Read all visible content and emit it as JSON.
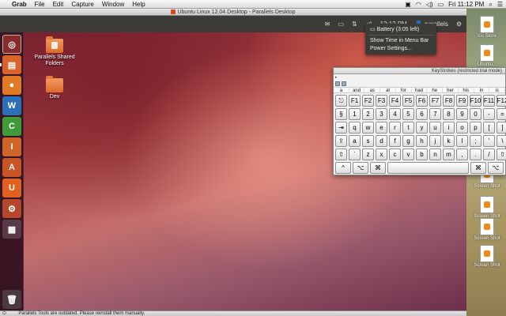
{
  "mac_menubar": {
    "apple_glyph": "",
    "app_name": "Grab",
    "menus": [
      "File",
      "Edit",
      "Capture",
      "Window",
      "Help"
    ],
    "clock": "Fri 11:12 PM"
  },
  "window": {
    "title": "Ubuntu Linux 12.04 Desktop - Parallels Desktop"
  },
  "ubuntu_panel": {
    "time": "12:12 PM",
    "user": "parallels"
  },
  "battery_menu": {
    "battery": "Battery (3:05 left)",
    "items": [
      "Show Time in Menu Bar",
      "Power Settings..."
    ]
  },
  "desktop_icons": [
    {
      "label_line1": "Parallels Shared",
      "label_line2": "Folders"
    },
    {
      "label_line1": "Dev",
      "label_line2": ""
    }
  ],
  "launcher": {
    "items": [
      "dash",
      "files",
      "firefox",
      "writer",
      "calc",
      "impress",
      "software-center",
      "ubuntu-one",
      "system-settings",
      "workspaces"
    ],
    "trash": "trash"
  },
  "keystrokes": {
    "title": "KeyStrokes (restricted trial mode)",
    "toolbar_arrow": "▸",
    "suggestions": [
      "a",
      "and",
      "as",
      "at",
      "for",
      "had",
      "he",
      "her",
      "his",
      "in",
      "is"
    ],
    "rows": [
      [
        "⎋",
        "F1",
        "F2",
        "F3",
        "F4",
        "F5",
        "F6",
        "F7",
        "F8",
        "F9",
        "F10",
        "F11",
        "F12"
      ],
      [
        "§",
        "1",
        "2",
        "3",
        "4",
        "5",
        "6",
        "7",
        "8",
        "9",
        "0",
        "-",
        "="
      ],
      [
        "⇥",
        "q",
        "w",
        "e",
        "r",
        "t",
        "y",
        "u",
        "i",
        "o",
        "p",
        "[",
        "]"
      ],
      [
        "⇪",
        "a",
        "s",
        "d",
        "f",
        "g",
        "h",
        "j",
        "k",
        "l",
        ";",
        "'",
        "\\"
      ],
      [
        "⇧",
        "`",
        "z",
        "x",
        "c",
        "v",
        "b",
        "n",
        "m",
        ",",
        ".",
        "/",
        "⇧"
      ],
      [
        "^",
        "⌥",
        "⌘",
        "",
        "⌘",
        "⌥"
      ]
    ]
  },
  "statusbar": {
    "message": "Parallels Tools are outdated. Please reinstall them manually."
  },
  "mac_desktop_icons": [
    {
      "label": "ios Store"
    },
    {
      "label": "Ubuntu..."
    },
    {
      "label": "Screen Shot"
    },
    {
      "label": "Screen Shot"
    },
    {
      "label": "Screen Shot"
    },
    {
      "label": "Screen Shot"
    }
  ],
  "colors": {
    "ubuntu_orange": "#dd4814",
    "panel": "#3c3b37"
  }
}
